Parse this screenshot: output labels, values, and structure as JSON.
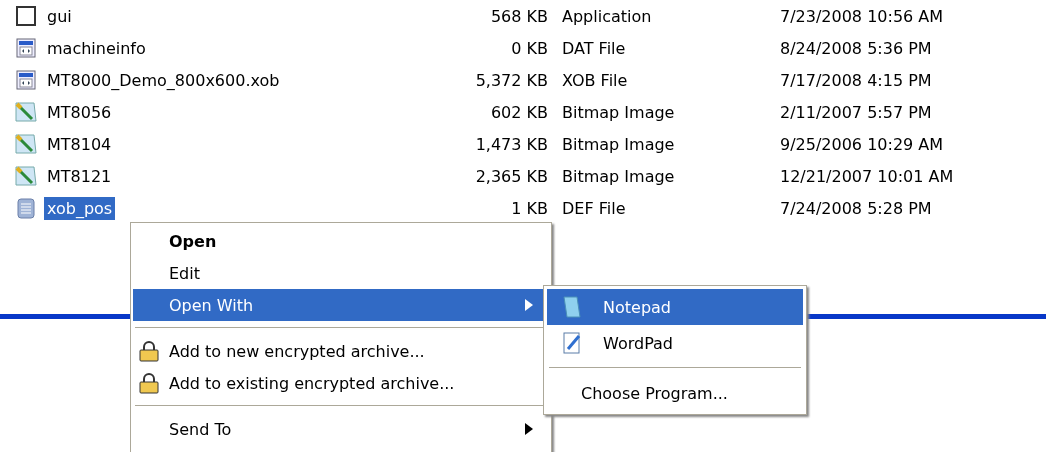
{
  "files": [
    {
      "name": "gui",
      "size": "568 KB",
      "type": "Application",
      "modified": "7/23/2008 10:56 AM",
      "kind": "blank",
      "selected": false
    },
    {
      "name": "machineinfo",
      "size": "0 KB",
      "type": "DAT File",
      "modified": "8/24/2008 5:36 PM",
      "kind": "app",
      "selected": false
    },
    {
      "name": "MT8000_Demo_800x600.xob",
      "size": "5,372 KB",
      "type": "XOB File",
      "modified": "7/17/2008 4:15 PM",
      "kind": "app",
      "selected": false
    },
    {
      "name": "MT8056",
      "size": "602 KB",
      "type": "Bitmap Image",
      "modified": "2/11/2007 5:57 PM",
      "kind": "bitmap",
      "selected": false
    },
    {
      "name": "MT8104",
      "size": "1,473 KB",
      "type": "Bitmap Image",
      "modified": "9/25/2006 10:29 AM",
      "kind": "bitmap",
      "selected": false
    },
    {
      "name": "MT8121",
      "size": "2,365 KB",
      "type": "Bitmap Image",
      "modified": "12/21/2007 10:01 AM",
      "kind": "bitmap",
      "selected": false
    },
    {
      "name": "xob_pos",
      "size": "1 KB",
      "type": "DEF File",
      "modified": "7/24/2008 5:28 PM",
      "kind": "text",
      "selected": true
    }
  ],
  "context_menu": {
    "items": [
      {
        "kind": "default",
        "label": "Open",
        "selected": false
      },
      {
        "kind": "plain",
        "label": "Edit",
        "selected": false
      },
      {
        "kind": "submenu",
        "label": "Open With",
        "selected": true
      },
      {
        "kind": "separator"
      },
      {
        "kind": "archive",
        "label": "Add to new encrypted archive...",
        "selected": false
      },
      {
        "kind": "archive",
        "label": "Add to existing encrypted archive...",
        "selected": false
      },
      {
        "kind": "separator"
      },
      {
        "kind": "submenu",
        "label": "Send To",
        "selected": false
      }
    ]
  },
  "open_with_menu": {
    "items": [
      {
        "kind": "program",
        "label": "Notepad",
        "selected": true
      },
      {
        "kind": "program",
        "label": "WordPad",
        "selected": false
      },
      {
        "kind": "separator"
      },
      {
        "kind": "plain",
        "label": "Choose Program...",
        "selected": false
      }
    ]
  }
}
